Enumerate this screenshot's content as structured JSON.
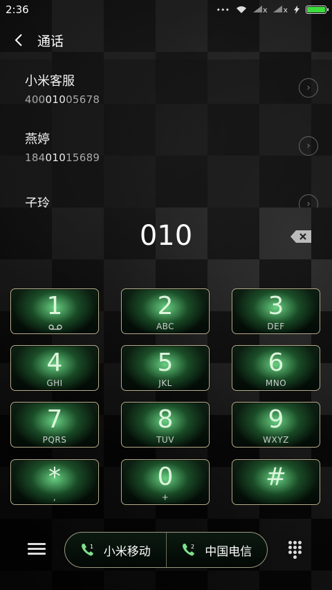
{
  "status_bar": {
    "time": "2:36",
    "sim1_label": "x",
    "sim2_label": "x"
  },
  "header": {
    "title": "通话"
  },
  "results": [
    {
      "name": "小米客服",
      "number_pre": "400",
      "number_match": "010",
      "number_post": "05678"
    },
    {
      "name": "燕婷",
      "number_pre": "184",
      "number_match": "010",
      "number_post": "15689"
    },
    {
      "name": "子玲",
      "number_pre": "",
      "number_match": "",
      "number_post": ""
    }
  ],
  "dialer": {
    "entered_digits": "010"
  },
  "keypad": [
    {
      "digit": "1",
      "letters": ""
    },
    {
      "digit": "2",
      "letters": "ABC"
    },
    {
      "digit": "3",
      "letters": "DEF"
    },
    {
      "digit": "4",
      "letters": "GHI"
    },
    {
      "digit": "5",
      "letters": "JKL"
    },
    {
      "digit": "6",
      "letters": "MNO"
    },
    {
      "digit": "7",
      "letters": "PQRS"
    },
    {
      "digit": "8",
      "letters": "TUV"
    },
    {
      "digit": "9",
      "letters": "WXYZ"
    },
    {
      "digit": "*",
      "letters": ","
    },
    {
      "digit": "0",
      "letters": "+"
    },
    {
      "digit": "#",
      "letters": ""
    }
  ],
  "bottom_bar": {
    "sim1": {
      "carrier": "小米移动",
      "badge": "1"
    },
    "sim2": {
      "carrier": "中国电信",
      "badge": "2"
    }
  },
  "colors": {
    "battery": "#3ddc3d",
    "key_glow": "#78f096",
    "key_border": "#b7b08d"
  },
  "icons": [
    "back-arrow-icon",
    "wifi-icon",
    "signal-icon",
    "charging-icon",
    "backspace-icon",
    "voicemail-icon",
    "menu-icon",
    "phone-icon",
    "keypad-icon",
    "chevron-right-icon"
  ]
}
